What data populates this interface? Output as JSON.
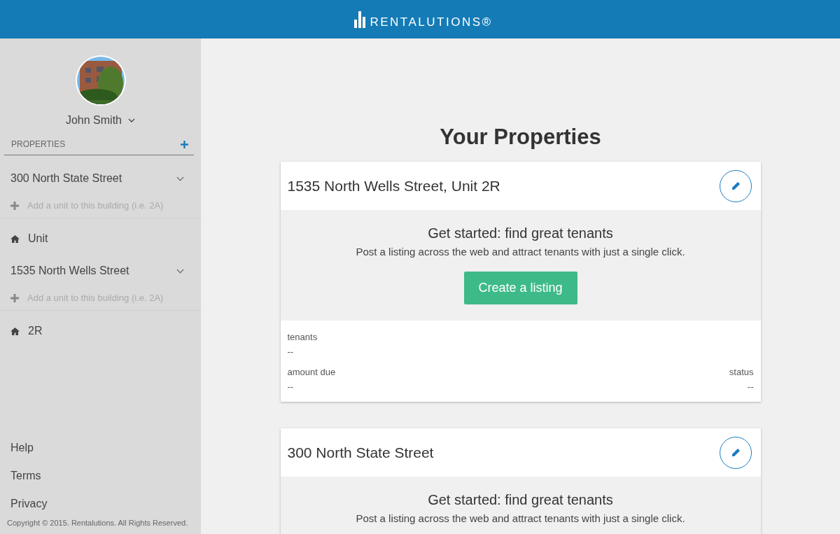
{
  "header": {
    "logo": "RENTALUTIONS®"
  },
  "sidebar": {
    "user": {
      "name": "John Smith"
    },
    "section_title": "PROPERTIES",
    "buildings": [
      {
        "name": "300 North State Street",
        "add_unit_placeholder": "Add a unit to this building (i.e. 2A)",
        "units": [
          "Unit"
        ]
      },
      {
        "name": "1535 North Wells Street",
        "add_unit_placeholder": "Add a unit to this building (i.e. 2A)",
        "units": [
          "2R"
        ]
      }
    ],
    "links": [
      "Help",
      "Terms",
      "Privacy"
    ],
    "copyright": "Copyright © 2015. Rentalutions. All Rights Reserved."
  },
  "main": {
    "title": "Your Properties",
    "cards": [
      {
        "title": "1535 North Wells Street, Unit 2R",
        "promo_heading": "Get started: find great tenants",
        "promo_text": "Post a listing across the web and attract tenants with just a single click.",
        "button": "Create a listing",
        "fields": [
          {
            "label": "tenants",
            "value": "--"
          },
          {
            "label": "amount due",
            "value": "--"
          },
          {
            "label": "status",
            "value": "--"
          }
        ]
      },
      {
        "title": "300 North State Street",
        "promo_heading": "Get started: find great tenants",
        "promo_text": "Post a listing across the web and attract tenants with just a single click."
      }
    ]
  }
}
